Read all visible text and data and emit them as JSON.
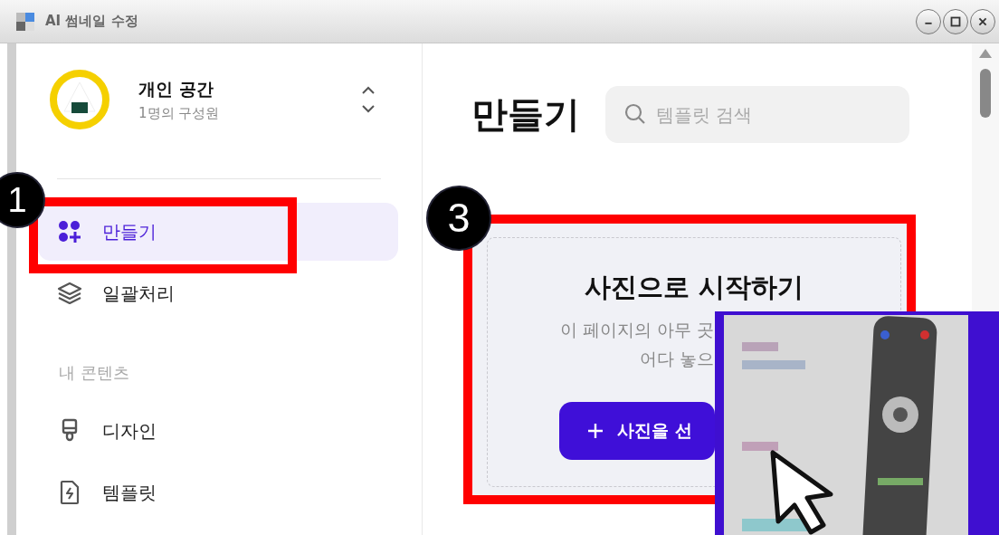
{
  "window": {
    "title": "AI 썸네일 수정"
  },
  "workspace": {
    "name": "개인 공간",
    "members": "1명의 구성원"
  },
  "sidebar": {
    "items": [
      {
        "label": "만들기",
        "selected": true,
        "kind": "apps"
      },
      {
        "label": "일괄처리",
        "selected": false,
        "kind": "layers"
      }
    ],
    "section_title": "내 콘텐츠",
    "content_items": [
      {
        "label": "디자인",
        "kind": "brush"
      },
      {
        "label": "템플릿",
        "kind": "file"
      }
    ]
  },
  "main": {
    "heading": "만들기",
    "search": {
      "placeholder": "템플릿 검색"
    },
    "card": {
      "title": "사진으로 시작하기",
      "description_lines": [
        "이 페이지의 아무 곳",
        "어다 놓으"
      ],
      "button": "사진을 선"
    }
  },
  "annotations": [
    {
      "label": "1"
    },
    {
      "label": "3"
    }
  ]
}
